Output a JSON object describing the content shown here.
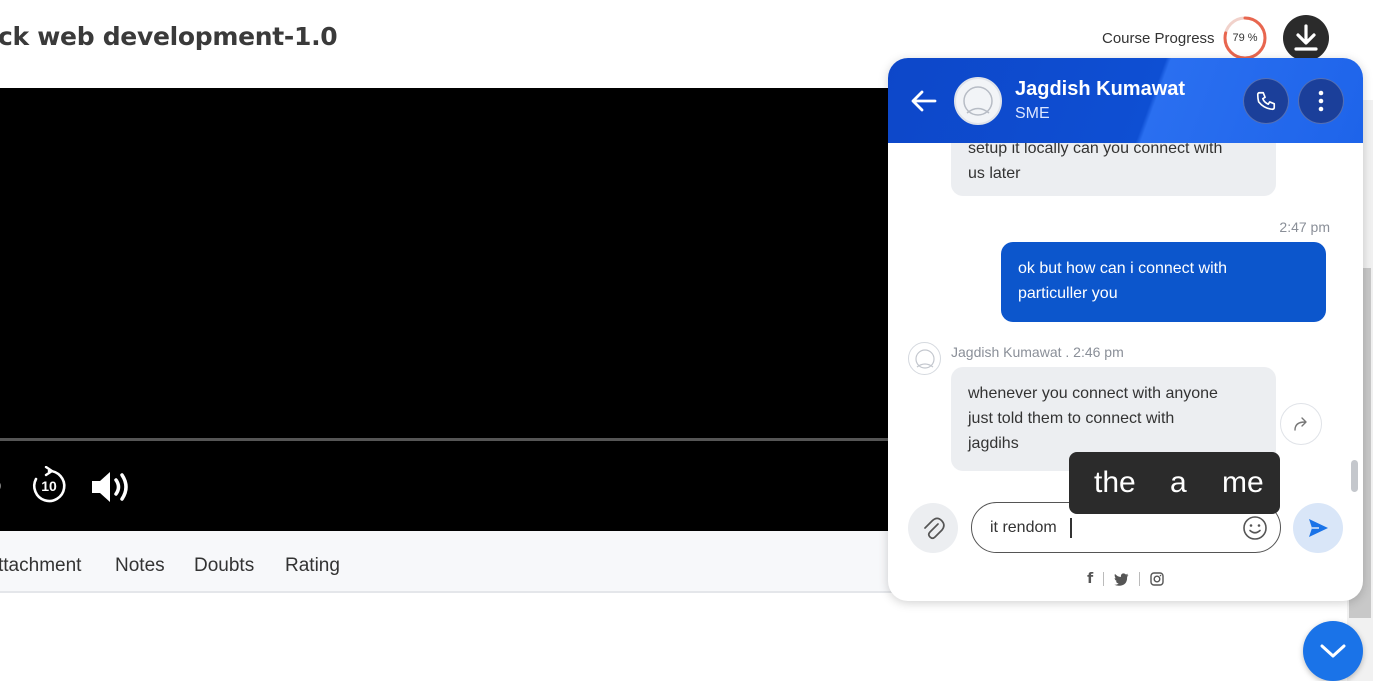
{
  "course": {
    "title": "ck web development-1.0"
  },
  "progress": {
    "label": "Course Progress",
    "value_text": "79 %",
    "percent": 79,
    "ring_color": "#e8664f"
  },
  "video": {
    "controls": [
      "replay-10-icon",
      "volume-icon"
    ],
    "replay_label": "10"
  },
  "tabs": [
    "ttachment",
    "Notes",
    "Doubts",
    "Rating"
  ],
  "chat": {
    "contact_name": "Jagdish Kumawat",
    "contact_role": "SME",
    "messages": [
      {
        "direction": "in",
        "lines": [
          "setup it locally can you connect with",
          "us later"
        ]
      },
      {
        "direction": "out",
        "time": "2:47 pm",
        "lines": [
          "ok but how can i connect with",
          "particuller you"
        ]
      },
      {
        "direction": "in",
        "meta": "Jagdish Kumawat . 2:46 pm",
        "lines": [
          "whenever you connect with anyone",
          "just told them to connect with",
          "jagdihs"
        ]
      }
    ],
    "input_value": "it rendom",
    "accent_color": "#0c56cc",
    "socials": [
      "facebook-icon",
      "twitter-icon",
      "instagram-icon"
    ]
  },
  "autocomplete": {
    "suggestions": [
      "the",
      "a",
      "me"
    ]
  }
}
